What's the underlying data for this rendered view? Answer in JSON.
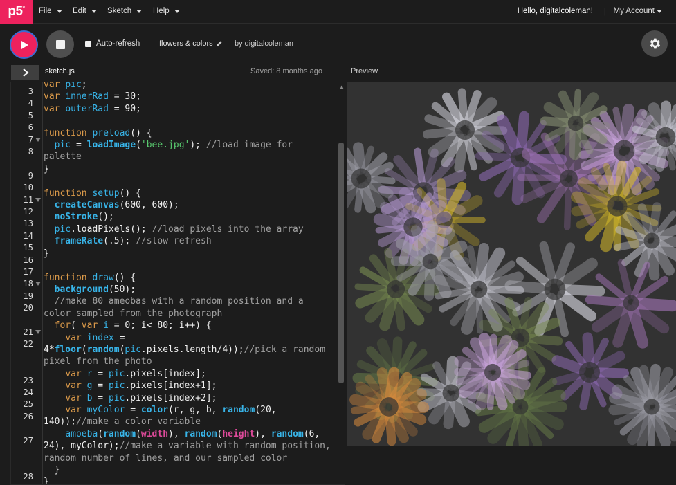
{
  "app": {
    "logo": "p5",
    "logo_sup": "*"
  },
  "nav": {
    "menus": [
      "File",
      "Edit",
      "Sketch",
      "Help"
    ],
    "greeting": "Hello, digitalcoleman!",
    "separator": "|",
    "account": "My Account"
  },
  "toolbar": {
    "auto_refresh_label": "Auto-refresh",
    "sketch_name": "flowers & colors",
    "byline": "by digitalcoleman"
  },
  "editor": {
    "filename": "sketch.js",
    "saved_status": "Saved: 8 months ago",
    "line_numbers": [
      "3",
      "4",
      "5",
      "6",
      "7",
      "8",
      "",
      "9",
      "10",
      "11",
      "12",
      "13",
      "14",
      "15",
      "16",
      "17",
      "18",
      "19",
      "20",
      "",
      "21",
      "22",
      "",
      "",
      "23",
      "24",
      "25",
      "26",
      "",
      "27",
      "",
      "",
      "28"
    ]
  },
  "preview": {
    "label": "Preview"
  },
  "colors": {
    "accent": "#ed225d",
    "focus_ring": "#3a6bd1",
    "background": "#1c1c1c"
  }
}
